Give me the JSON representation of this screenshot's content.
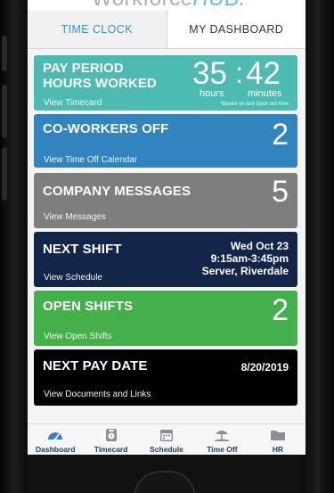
{
  "app": {
    "brand_left": "Workforce",
    "brand_right": "HUB."
  },
  "tabs": [
    {
      "label": "TIME CLOCK",
      "active": false
    },
    {
      "label": "MY DASHBOARD",
      "active": true
    }
  ],
  "cards": {
    "pay_period": {
      "title_line1": "PAY PERIOD",
      "title_line2": "HOURS WORKED",
      "hours": "35",
      "minutes": "42",
      "separator": ":",
      "hours_label": "hours",
      "minutes_label": "minutes",
      "footnote": "*Based on last clock out time",
      "link": "View Timecard",
      "color": "#4dbbb1"
    },
    "coworkers_off": {
      "title": "CO-WORKERS OFF",
      "value": "2",
      "link": "View Time Off Calendar",
      "color": "#3284be"
    },
    "company_messages": {
      "title": "COMPANY MESSAGES",
      "value": "5",
      "link": "View Messages",
      "color": "#7e7e7e"
    },
    "next_shift": {
      "title": "NEXT SHIFT",
      "date": "Wed Oct 23",
      "time": "9:15am-3:45pm",
      "position": "Server, Riverdale",
      "link": "View Schedule",
      "color": "#14254a"
    },
    "open_shifts": {
      "title": "OPEN SHIFTS",
      "value": "2",
      "link": "View Open Shifts",
      "color": "#43b04b"
    },
    "next_pay_date": {
      "title": "NEXT PAY DATE",
      "date": "8/20/2019",
      "link": "View Documents and Links",
      "color": "#000000"
    }
  },
  "bottom_nav": [
    {
      "label": "Dashboard",
      "icon": "dashboard-gauge-icon"
    },
    {
      "label": "Timecard",
      "icon": "timecard-icon"
    },
    {
      "label": "Schedule",
      "icon": "calendar-icon"
    },
    {
      "label": "Time Off",
      "icon": "beach-umbrella-icon"
    },
    {
      "label": "HR",
      "icon": "folder-icon"
    }
  ]
}
